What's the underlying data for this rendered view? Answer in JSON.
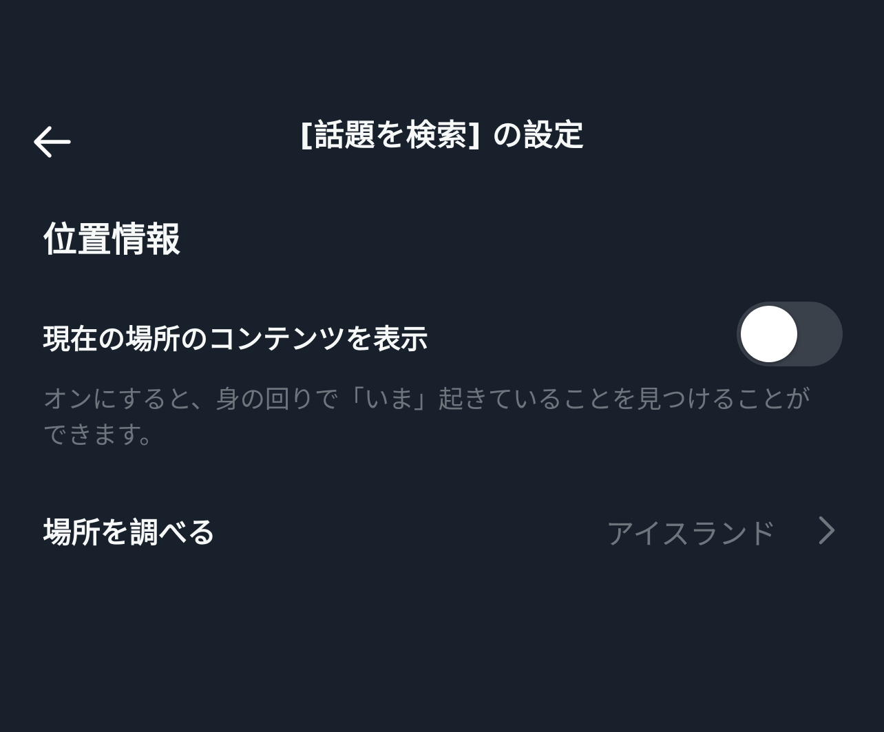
{
  "header": {
    "title": "[話題を検索] の設定"
  },
  "location": {
    "section_title": "位置情報",
    "toggle_label": "現在の場所のコンテンツを表示",
    "toggle_on": false,
    "description": "オンにすると、身の回りで「いま」起きていることを見つけることができます。"
  },
  "explore": {
    "label": "場所を調べる",
    "value": "アイスランド"
  },
  "icons": {
    "back": "arrow-left-icon",
    "chevron": "chevron-right-icon"
  }
}
